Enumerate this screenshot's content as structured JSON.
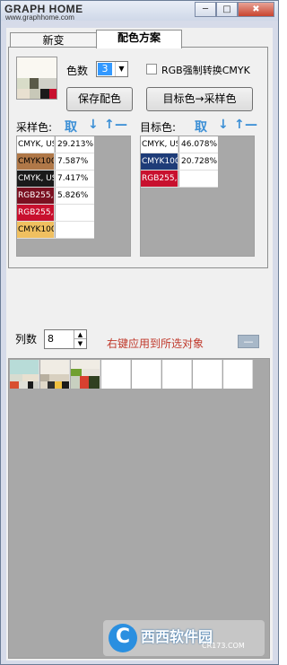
{
  "app": {
    "logo": "GRAPH HOME",
    "logo_sub": "www.graphhome.com",
    "win_min": "─",
    "win_max": "□",
    "win_close": "✖"
  },
  "tabs": [
    "新变",
    "配色方案"
  ],
  "config": {
    "color_count_label": "色数",
    "color_count_value": "3",
    "rgb_to_cmyk_label": "RGB强制转换CMYK",
    "save_button": "保存配色",
    "target_to_sample_button": "目标色→采样色"
  },
  "sample": {
    "label": "采样色:",
    "tool_get": "取",
    "tool_down": "↓",
    "tool_up": "↑",
    "tool_minus": "—",
    "rows": [
      {
        "name": "CMYK, US",
        "pct": "29.213%",
        "color": "#ffffff",
        "text": "#000000"
      },
      {
        "name": "CMYK100",
        "pct": "7.587%",
        "color": "#b07848",
        "text": "#000000"
      },
      {
        "name": "CMYK, US",
        "pct": "7.417%",
        "color": "#1a1a1a",
        "text": "#ffffff"
      },
      {
        "name": "RGB255,",
        "pct": "5.826%",
        "color": "#7a1020",
        "text": "#ffffff"
      },
      {
        "name": "RGB255,",
        "pct": "",
        "color": "#c8102e",
        "text": "#ffffff"
      },
      {
        "name": "CMYK100",
        "pct": "",
        "color": "#f0c060",
        "text": "#000000"
      }
    ]
  },
  "target": {
    "label": "目标色:",
    "tool_get": "取",
    "tool_down": "↓",
    "tool_up": "↑",
    "tool_minus": "—",
    "rows": [
      {
        "name": "CMYK, US",
        "pct": "46.078%",
        "color": "#ffffff",
        "text": "#000000"
      },
      {
        "name": "CMYK100",
        "pct": "20.728%",
        "color": "#1e3c78",
        "text": "#ffffff"
      },
      {
        "name": "RGB255,",
        "pct": "",
        "color": "#c8102e",
        "text": "#ffffff"
      }
    ]
  },
  "columns": {
    "label": "列数",
    "value": "8",
    "hint": "右键应用到所选对象",
    "minus": "—"
  },
  "watermark": {
    "logo": "C",
    "text": "西西软件园",
    "sub": "CR173.COM"
  }
}
